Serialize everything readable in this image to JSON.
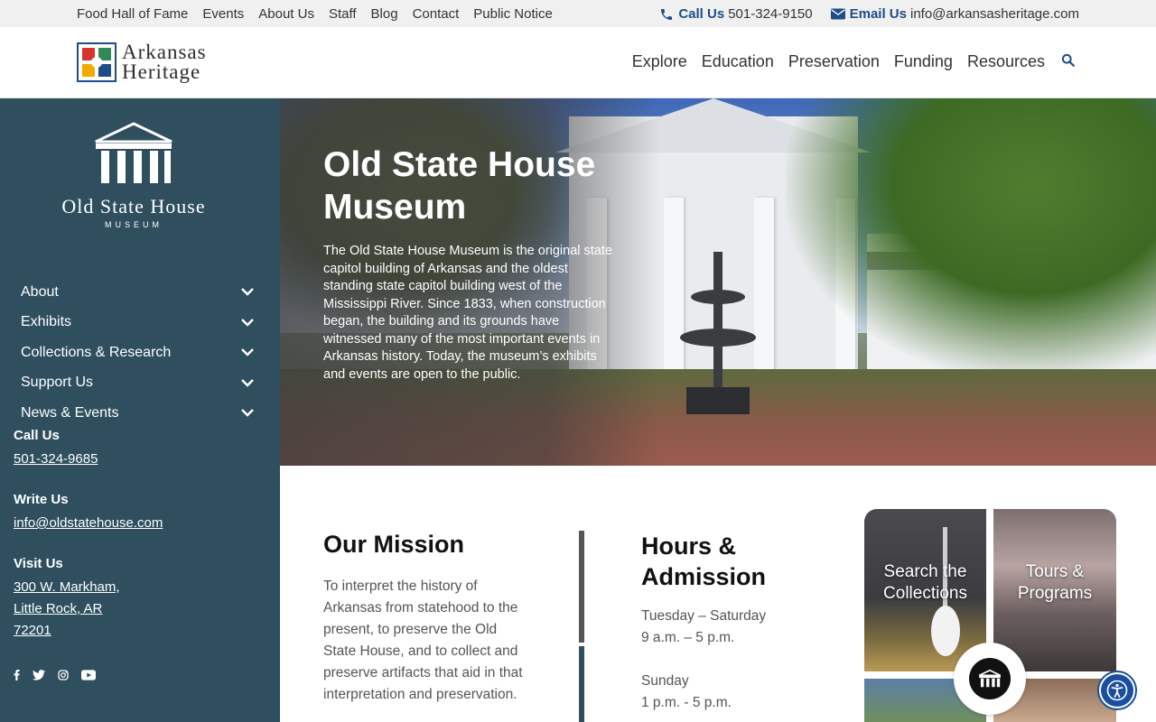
{
  "topbar": {
    "links": [
      "Food Hall of Fame",
      "Events",
      "About Us",
      "Staff",
      "Blog",
      "Contact",
      "Public Notice"
    ],
    "call_label": "Call Us",
    "call_number": "501-324-9150",
    "email_label": "Email Us",
    "email_address": "info@arkansasheritage.com"
  },
  "header": {
    "logo_line1": "Arkansas",
    "logo_line2": "Heritage",
    "nav": [
      "Explore",
      "Education",
      "Preservation",
      "Funding",
      "Resources"
    ]
  },
  "sidebar": {
    "logo_name": "Old State House",
    "logo_sub": "MUSEUM",
    "menu": [
      "About",
      "Exhibits",
      "Collections & Research",
      "Support Us",
      "News & Events"
    ],
    "call_heading": "Call Us",
    "call_number": "501-324-9685",
    "write_heading": "Write Us",
    "write_email": "info@oldstatehouse.com",
    "visit_heading": "Visit Us",
    "visit_line1": "300 W. Markham,",
    "visit_line2": "Little Rock, AR",
    "visit_line3": "72201"
  },
  "hero": {
    "title": "Old State House Museum",
    "text": "The Old State House Museum is the original state capitol building of Arkansas and the oldest standing state capitol building west of the Mississippi River. Since 1833, when construction began, the building and its grounds have witnessed many of the most important events in Arkansas history. Today, the museum’s exhibits and events are open to the public."
  },
  "mission": {
    "title": "Our Mission",
    "text": "To interpret the history of Arkansas from statehood to the present, to preserve the Old State House, and to collect and preserve artifacts that aid in that interpretation and preservation."
  },
  "hours": {
    "title": "Hours & Admission",
    "line1": "Tuesday – Saturday",
    "line2": "9 a.m. – 5 p.m.",
    "line3": "Sunday",
    "line4": "1 p.m. - 5 p.m."
  },
  "tiles": {
    "t1": "Search the Collections",
    "t2": "Tours & Programs"
  },
  "colors": {
    "sidebar": "#2f4f5f",
    "brand_blue": "#1d4e89"
  }
}
